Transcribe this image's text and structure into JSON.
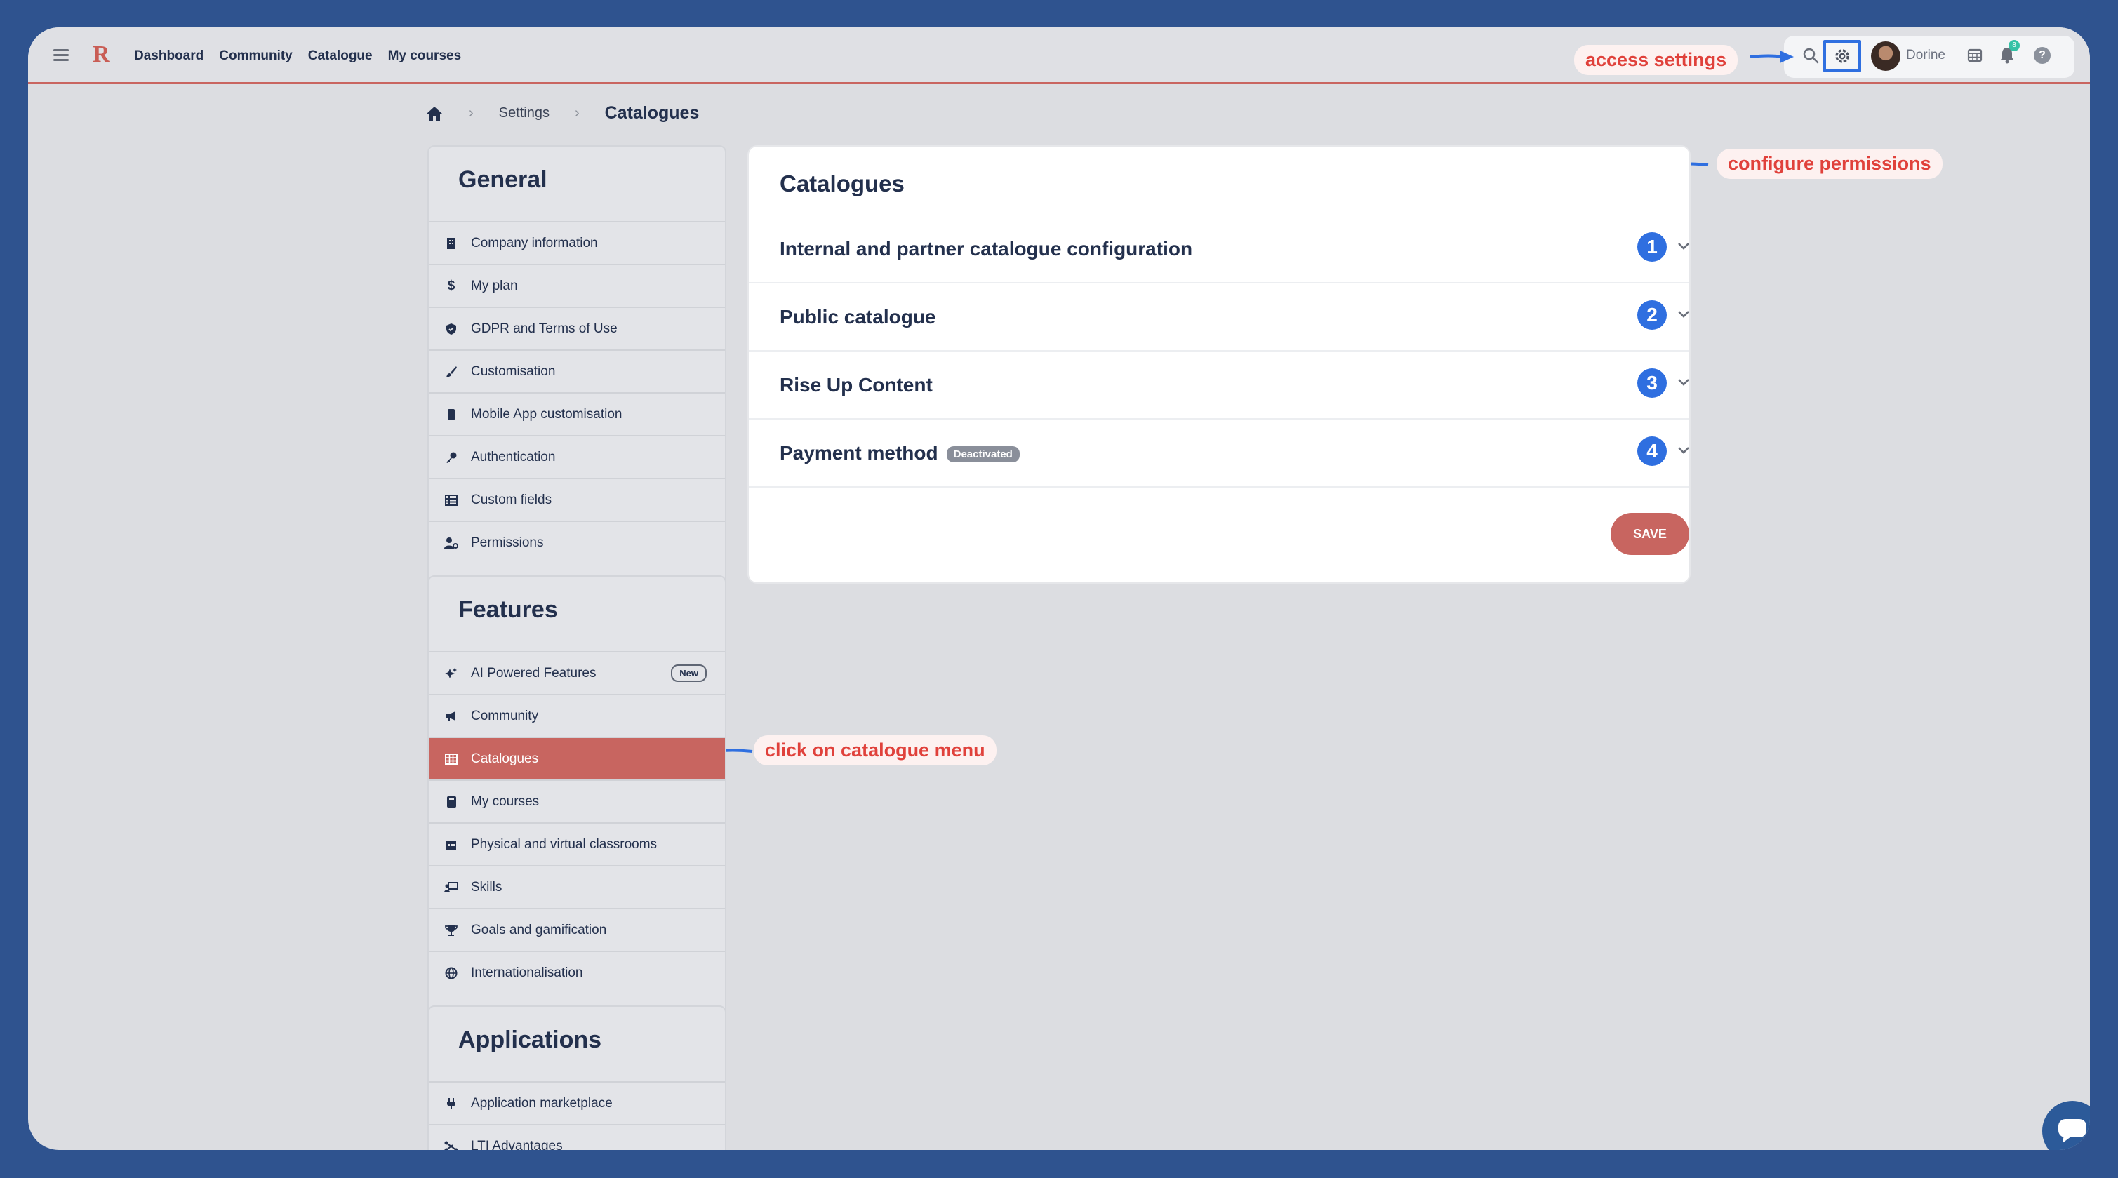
{
  "topbar": {
    "logo": "R",
    "nav": [
      "Dashboard",
      "Community",
      "Catalogue",
      "My courses"
    ],
    "username": "Dorine",
    "notification_count": "8"
  },
  "callouts": {
    "access_settings": "access settings",
    "configure_permissions": "configure permissions",
    "click_catalogue": "click on catalogue menu"
  },
  "breadcrumb": {
    "settings": "Settings",
    "current": "Catalogues"
  },
  "general": {
    "title": "General",
    "items": [
      {
        "label": "Company information",
        "icon": "building-icon"
      },
      {
        "label": "My plan",
        "icon": "dollar-icon"
      },
      {
        "label": "GDPR and Terms of Use",
        "icon": "shield-icon"
      },
      {
        "label": "Customisation",
        "icon": "brush-icon"
      },
      {
        "label": "Mobile App customisation",
        "icon": "mobile-icon"
      },
      {
        "label": "Authentication",
        "icon": "key-icon"
      },
      {
        "label": "Custom fields",
        "icon": "table-icon"
      },
      {
        "label": "Permissions",
        "icon": "user-gear-icon"
      }
    ]
  },
  "features": {
    "title": "Features",
    "items": [
      {
        "label": "AI Powered Features",
        "icon": "sparkle-icon",
        "badge": "New"
      },
      {
        "label": "Community",
        "icon": "megaphone-icon"
      },
      {
        "label": "Catalogues",
        "icon": "grid-icon",
        "active": true
      },
      {
        "label": "My courses",
        "icon": "book-icon"
      },
      {
        "label": "Physical and virtual classrooms",
        "icon": "calendar-icon"
      },
      {
        "label": "Skills",
        "icon": "chalkboard-icon"
      },
      {
        "label": "Goals and gamification",
        "icon": "trophy-icon"
      },
      {
        "label": "Internationalisation",
        "icon": "globe-icon"
      }
    ]
  },
  "applications": {
    "title": "Applications",
    "items": [
      {
        "label": "Application marketplace",
        "icon": "plug-icon"
      },
      {
        "label": "LTI Advantages",
        "icon": "network-icon"
      }
    ]
  },
  "main": {
    "title": "Catalogues",
    "sections": [
      {
        "label": "Internal and partner catalogue configuration",
        "number": "1"
      },
      {
        "label": "Public catalogue",
        "number": "2"
      },
      {
        "label": "Rise Up Content",
        "number": "3"
      },
      {
        "label": "Payment method",
        "number": "4",
        "badge": "Deactivated"
      }
    ],
    "save_label": "SAVE"
  },
  "colors": {
    "accent": "#c86560",
    "highlight_blue": "#2f6fe0",
    "callout_text": "#e0413b"
  }
}
